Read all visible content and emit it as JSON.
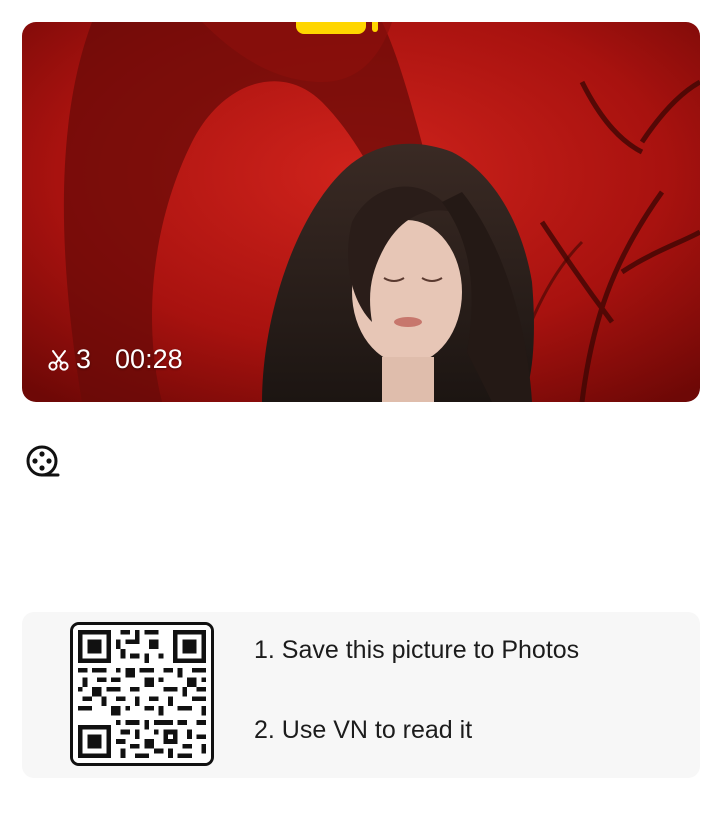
{
  "video": {
    "clip_count": "3",
    "duration": "00:28",
    "scissors_icon": "scissors-icon"
  },
  "film_icon": "film-reel-icon",
  "qr_card": {
    "step1": "1. Save this picture to Photos",
    "step2": "2. Use VN to read it"
  },
  "colors": {
    "thumbnail_red": "#b81412",
    "accent_yellow": "#ffd600",
    "card_bg": "#f7f7f7"
  }
}
